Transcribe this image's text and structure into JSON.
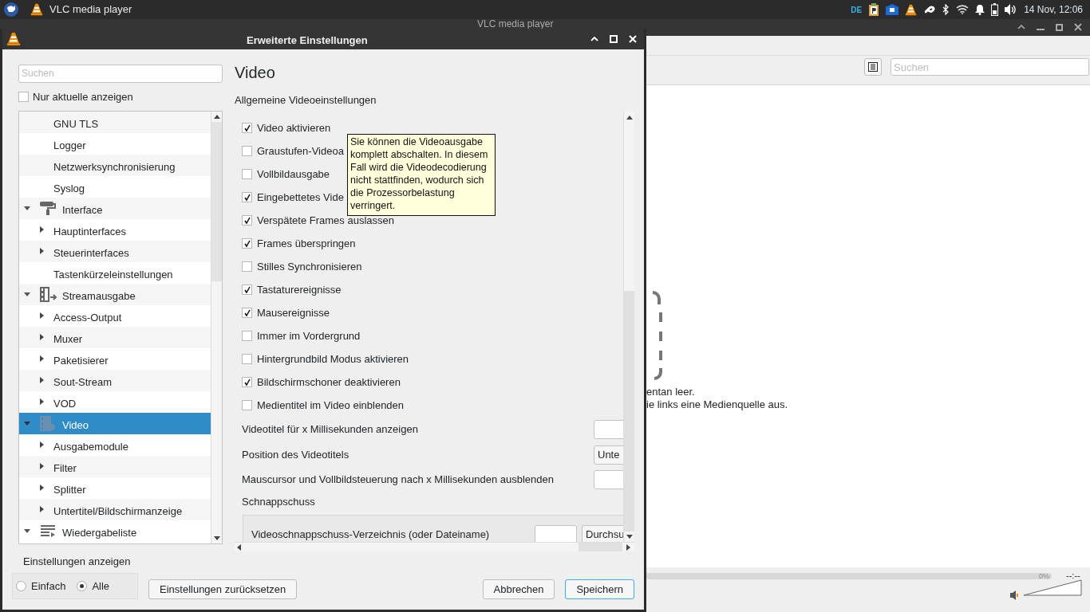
{
  "top_panel": {
    "app_title": "VLC media player",
    "keyboard_layout": "DE",
    "clock": "14 Nov, 12:06"
  },
  "main_window": {
    "title": "VLC media player",
    "search": {
      "placeholder": "Suchen"
    },
    "empty_message": [
      "entan leer.",
      "ie links eine Medienquelle aus."
    ],
    "time": "--:--",
    "volume": {
      "reading": "0%",
      "level": 0
    }
  },
  "dialog": {
    "title": "Erweiterte Einstellungen",
    "search": {
      "placeholder": "Suchen"
    },
    "only_current": {
      "label": "Nur aktuelle anzeigen",
      "checked": false
    },
    "tree": [
      {
        "children": [
          {
            "label": "GNU TLS",
            "selected": false
          },
          {
            "label": "Logger",
            "selected": false
          },
          {
            "label": "Netzwerksynchronisierung",
            "selected": false
          },
          {
            "label": "Syslog",
            "selected": false
          }
        ]
      },
      {
        "label": "Interface",
        "kind": "interface",
        "expanded": true,
        "selected": false,
        "children": [
          {
            "label": "Hauptinterfaces",
            "expanded": false,
            "selected": false
          },
          {
            "label": "Steuerinterfaces",
            "expanded": false,
            "selected": false
          },
          {
            "label": "Tastenkürzeleinstellungen",
            "selected": false
          }
        ]
      },
      {
        "label": "Streamausgabe",
        "kind": "stream",
        "expanded": true,
        "selected": false,
        "children": [
          {
            "label": "Access-Output",
            "expanded": false,
            "selected": false
          },
          {
            "label": "Muxer",
            "expanded": false,
            "selected": false
          },
          {
            "label": "Paketisierer",
            "expanded": false,
            "selected": false
          },
          {
            "label": "Sout-Stream",
            "expanded": false,
            "selected": false
          },
          {
            "label": "VOD",
            "expanded": false,
            "selected": false
          }
        ]
      },
      {
        "label": "Video",
        "kind": "video",
        "expanded": true,
        "selected": true,
        "children": [
          {
            "label": "Ausgabemodule",
            "expanded": false,
            "selected": false
          },
          {
            "label": "Filter",
            "expanded": false,
            "selected": false
          },
          {
            "label": "Splitter",
            "expanded": false,
            "selected": false
          },
          {
            "label": "Untertitel/Bildschirmanzeige",
            "expanded": false,
            "selected": false
          }
        ]
      },
      {
        "label": "Wiedergabeliste",
        "kind": "playlist",
        "expanded": true,
        "selected": false
      }
    ],
    "heading": "Video",
    "subheading": "Allgemeine Videoeinstellungen",
    "settings": [
      {
        "kind": "checkbox",
        "label": "Video aktivieren",
        "checked": true
      },
      {
        "kind": "checkbox",
        "label": "Graustufen-Videoa",
        "checked": false
      },
      {
        "kind": "checkbox",
        "label": "Vollbildausgabe",
        "checked": false
      },
      {
        "kind": "checkbox",
        "label": "Eingebettetes Vide",
        "checked": true
      },
      {
        "kind": "checkbox",
        "label": "Verspätete Frames auslassen",
        "checked": true
      },
      {
        "kind": "checkbox",
        "label": "Frames überspringen",
        "checked": true
      },
      {
        "kind": "checkbox",
        "label": "Stilles Synchronisieren",
        "checked": false
      },
      {
        "kind": "checkbox",
        "label": "Tastaturereignisse",
        "checked": true
      },
      {
        "kind": "checkbox",
        "label": "Mausereignisse",
        "checked": true
      },
      {
        "kind": "checkbox",
        "label": "Immer im Vordergrund",
        "checked": false
      },
      {
        "kind": "checkbox",
        "label": "Hintergrundbild Modus aktivieren",
        "checked": false
      },
      {
        "kind": "checkbox",
        "label": "Bildschirmschoner deaktivieren",
        "checked": true
      },
      {
        "kind": "checkbox",
        "label": "Medientitel im Video einblenden",
        "checked": false
      },
      {
        "kind": "number",
        "label": "Videotitel für x Millisekunden anzeigen"
      },
      {
        "kind": "select",
        "label": "Position des Videotitels",
        "value": "Unte"
      },
      {
        "kind": "number",
        "label": "Mauscursor und Vollbildsteuerung nach x Millisekunden ausblenden"
      },
      {
        "kind": "section",
        "label": "Schnappschuss"
      },
      {
        "kind": "file",
        "label": "Videoschnappschuss-Verzeichnis (oder Dateiname)",
        "button": "Durchsu"
      }
    ],
    "tooltip": "Sie können die Videoausgabe komplett abschalten. In diesem Fall wird die Videodecodierung nicht stattfinden, wodurch sich die Prozessorbelastung verringert.",
    "show_settings": {
      "label": "Einstellungen anzeigen",
      "options": [
        {
          "label": "Einfach",
          "selected": false
        },
        {
          "label": "Alle",
          "selected": true
        }
      ]
    },
    "buttons": [
      {
        "label": "Einstellungen zurücksetzen",
        "default": false
      },
      {
        "label": "Abbrechen",
        "default": false
      },
      {
        "label": "Speichern",
        "default": true
      }
    ]
  }
}
